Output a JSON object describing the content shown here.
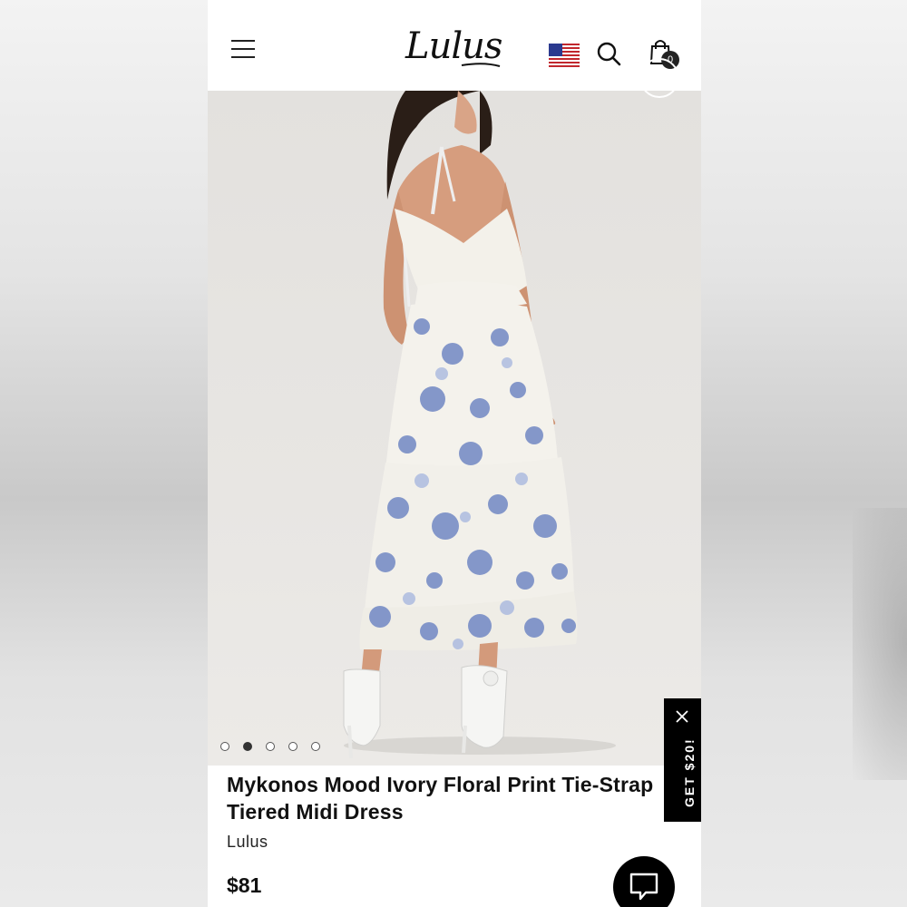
{
  "header": {
    "logo_text": "Lulus",
    "cart_count": "0",
    "icons": [
      "hamburger-menu-icon",
      "us-flag-icon",
      "search-icon",
      "shopping-bag-icon"
    ]
  },
  "gallery": {
    "slide_count": 5,
    "active_slide": 2
  },
  "product": {
    "title": "Mykonos Mood Ivory Floral Print Tie-Strap Tiered Midi Dress",
    "brand": "Lulus",
    "price": "$81"
  },
  "promo": {
    "label": "GET $20!"
  },
  "colors": {
    "dress_ivory": "#f4f2ec",
    "dress_floral_blue": "#6f86c2",
    "heels_white": "#f5f5f3",
    "background_gray": "#e4e2df"
  }
}
